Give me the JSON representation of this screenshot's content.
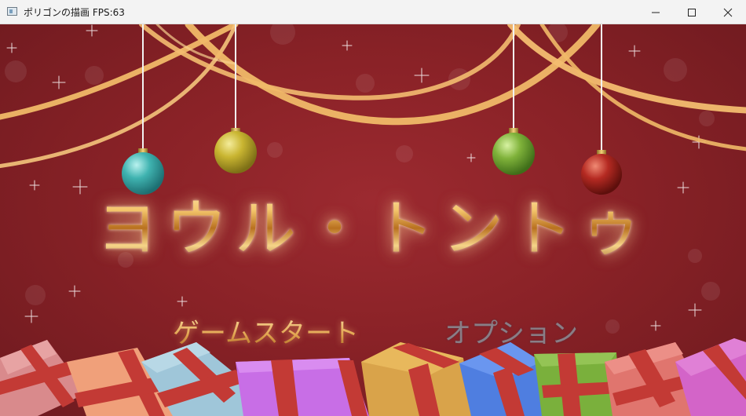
{
  "window": {
    "title": "ポリゴンの描画 FPS:63",
    "controls": [
      "minimize",
      "maximize",
      "close"
    ]
  },
  "game": {
    "title": "ヨウル・トントゥ",
    "menu": {
      "start_label": "ゲームスタート",
      "option_label": "オプション",
      "selected": "start"
    },
    "ornaments": [
      {
        "color": "#3fb3b0",
        "name": "teal-ornament"
      },
      {
        "color": "#c9b531",
        "name": "yellow-ornament"
      },
      {
        "color": "#7fb23a",
        "name": "green-ornament"
      },
      {
        "color": "#b52a22",
        "name": "red-ornament"
      }
    ],
    "colors": {
      "background": "#8a2227",
      "ribbon": "#f0b968",
      "title_gold": "#f3c46a"
    }
  }
}
